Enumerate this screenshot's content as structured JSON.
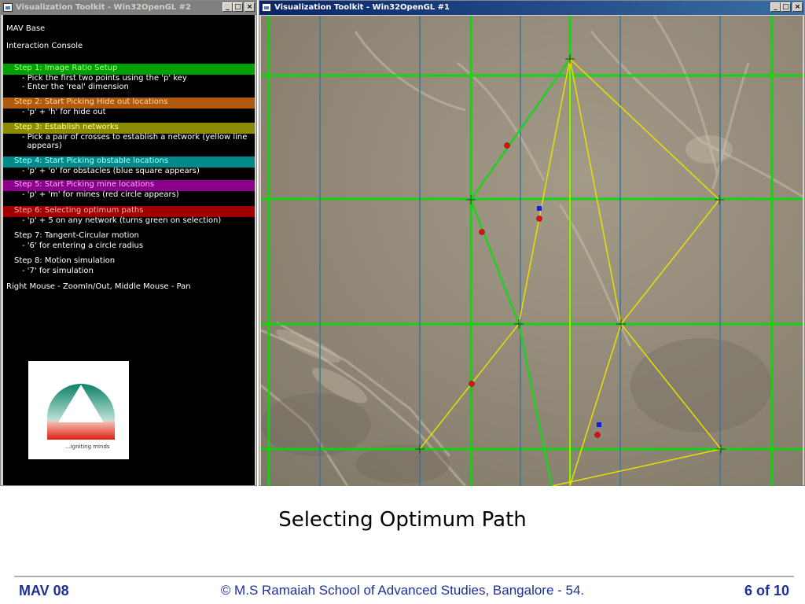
{
  "windows": {
    "console": {
      "title": "Visualization Toolkit - Win32OpenGL #2",
      "buttons": {
        "minimize": "_",
        "maximize": "□",
        "close": "×"
      }
    },
    "map": {
      "title": "Visualization Toolkit - Win32OpenGL #1",
      "buttons": {
        "minimize": "_",
        "maximize": "□",
        "close": "×"
      }
    }
  },
  "console": {
    "header1": "MAV Base",
    "header2": "Interaction Console",
    "steps": [
      {
        "title": "Step 1: Image Ratio Setup",
        "color": "#00a000",
        "text_color": "#a8ff90",
        "lines": [
          "- Pick the first two points using the 'p' key",
          "- Enter the 'real' dimension"
        ]
      },
      {
        "title": "Step 2: Start Picking Hide out locations",
        "color": "#b05a10",
        "text_color": "#ffd8a0",
        "lines": [
          "- 'p' + 'h' for hide out"
        ]
      },
      {
        "title": "Step 3: Establish networks",
        "color": "#8c8c00",
        "text_color": "#ffff90",
        "lines": [
          "- Pick a pair of crosses to establish a network (yellow line",
          "  appears)"
        ]
      },
      {
        "title": "Step 4: Start Picking obstable locations",
        "color": "#008a8a",
        "text_color": "#b0ffff",
        "lines": [
          "- 'p' + 'o' for obstacles (blue square appears)"
        ]
      },
      {
        "title": "Step 5: Start Picking mine locations",
        "color": "#8a008a",
        "text_color": "#ffb0ff",
        "lines": [
          "- 'p' + 'm' for mines (red circle appears)"
        ]
      },
      {
        "title": "Step 6: Selecting optimum paths",
        "color": "#a00000",
        "text_color": "#ffb0b0",
        "lines": [
          "- 'p' + 5 on any network (turns green on selection)"
        ]
      },
      {
        "title": "Step 7: Tangent-Circular motion",
        "color": "#000000",
        "text_color": "#ffffff",
        "lines": [
          "- '6' for entering a circle radius"
        ]
      },
      {
        "title": "Step 8: Motion simulation",
        "color": "#000000",
        "text_color": "#ffffff",
        "lines": [
          "- '7' for simulation"
        ]
      }
    ],
    "footer_hint": "Right Mouse - ZoomIn/Out, Middle Mouse - Pan",
    "logo_caption": "...igniting minds"
  },
  "map": {
    "grid_color": "#00e000",
    "network_color": "#e8e000",
    "selected_path_color": "#20d020",
    "mine_color": "#e01010",
    "obstacle_color": "#1020e0"
  },
  "slide": {
    "title": "Selecting Optimum Path",
    "footer_left": "MAV 08",
    "footer_center": "© M.S Ramaiah School of Advanced Studies, Bangalore - 54.",
    "footer_right": "6 of 10"
  }
}
